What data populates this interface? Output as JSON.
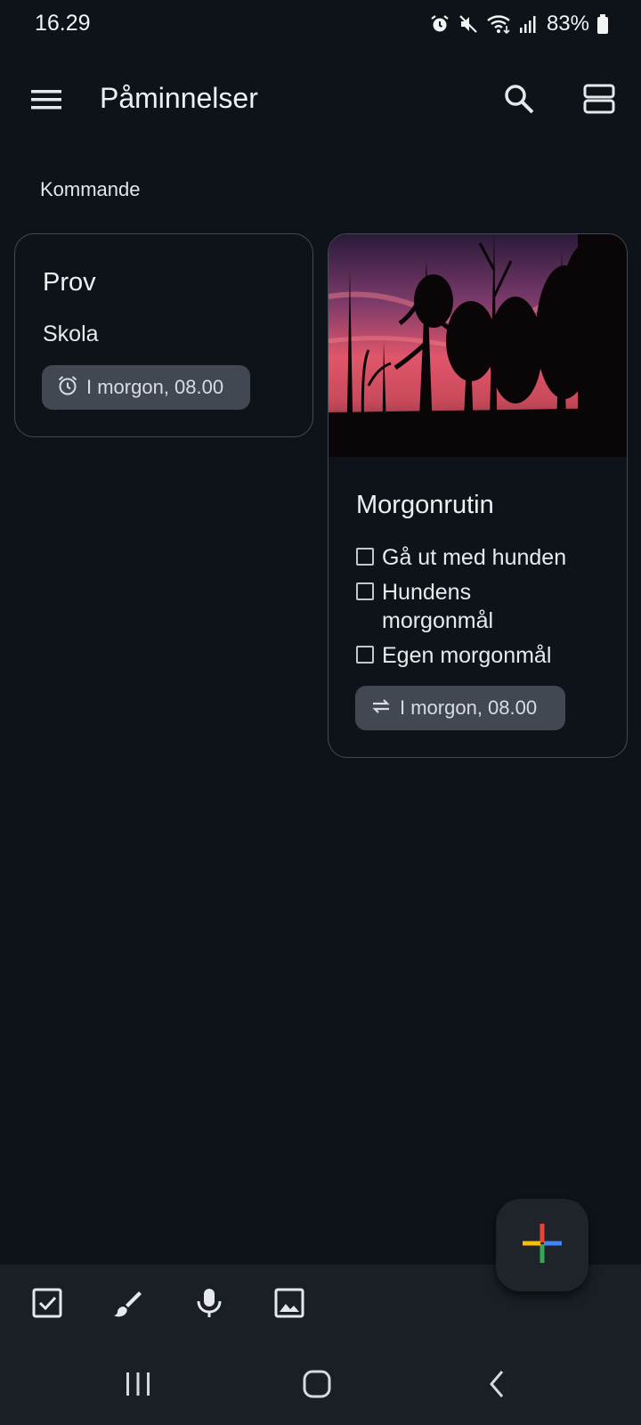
{
  "status_bar": {
    "time": "16.29",
    "battery_percent": "83%",
    "icons": [
      "alarm-icon",
      "mute-icon",
      "wifi-icon",
      "signal-icon",
      "battery-icon"
    ]
  },
  "app_bar": {
    "title": "Påminnelser",
    "icons": [
      "menu-icon",
      "search-icon",
      "list-layout-icon"
    ]
  },
  "section": {
    "label": "Kommande"
  },
  "notes": [
    {
      "title": "Prov",
      "body": "Skola",
      "reminder": "I morgon, 08.00",
      "reminder_icon": "alarm-icon"
    },
    {
      "title": "Morgonrutin",
      "image": "sunset-forest-photo",
      "checklist": [
        "Gå ut med hunden",
        "Hundens morgonmål",
        "Egen morgonmål"
      ],
      "reminder": "I morgon, 08.00",
      "reminder_icon": "repeat-icon"
    }
  ],
  "fab": {
    "icon": "plus-icon",
    "colors": [
      "#ea4335",
      "#4285f4",
      "#34a853",
      "#fbbc04"
    ]
  },
  "bottom_toolbar": {
    "icons": [
      "checkbox-icon",
      "brush-icon",
      "mic-icon",
      "image-icon"
    ]
  },
  "nav_bar": {
    "icons": [
      "recents-icon",
      "home-icon",
      "back-icon"
    ]
  },
  "colors": {
    "background": "#0e131a",
    "card_border": "#434a53",
    "chip": "#424851",
    "toolbar": "#1a1f26"
  }
}
